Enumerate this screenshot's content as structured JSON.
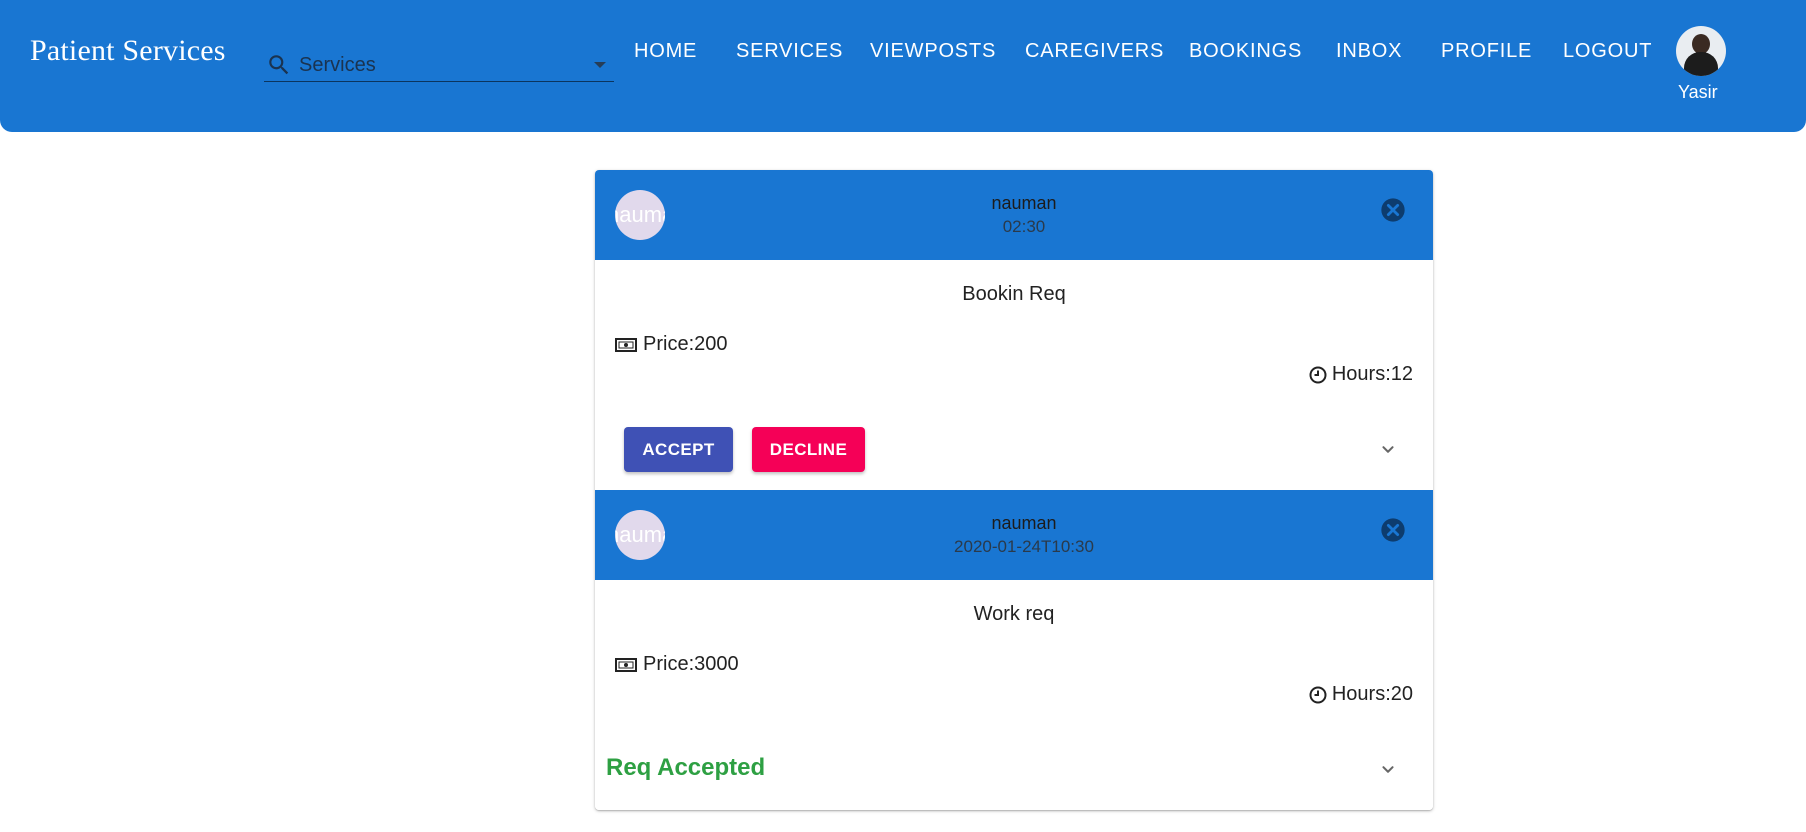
{
  "app": {
    "title": "Patient Services"
  },
  "search": {
    "value": "Services"
  },
  "nav": {
    "items": [
      {
        "label": "HOME"
      },
      {
        "label": "SERVICES"
      },
      {
        "label": "VIEWPOSTS"
      },
      {
        "label": "CAREGIVERS"
      },
      {
        "label": "BOOKINGS"
      },
      {
        "label": "INBOX"
      },
      {
        "label": "PROFILE"
      },
      {
        "label": "LOGOUT"
      }
    ]
  },
  "user": {
    "name": "Yasir"
  },
  "requests": [
    {
      "avatar_text": "nauman",
      "name": "nauman",
      "time": "02:30",
      "title": "Bookin Req",
      "price": "Price:200",
      "hours": "Hours:12",
      "actions": {
        "accept": "ACCEPT",
        "decline": "DECLINE"
      }
    },
    {
      "avatar_text": "nauman",
      "name": "nauman",
      "time": "2020-01-24T10:30",
      "title": "Work req",
      "price": "Price:3000",
      "hours": "Hours:20",
      "status": "Req Accepted"
    }
  ],
  "colors": {
    "primary": "#1976d2",
    "accept": "#3f51b5",
    "decline": "#f50057",
    "accepted_status": "#2ea043"
  },
  "icons": {
    "search": "search-icon",
    "dropdown": "arrow-drop-down-icon",
    "close": "cancel-circle-icon",
    "money": "money-icon",
    "clock": "clock-icon",
    "expand": "chevron-down-icon"
  }
}
